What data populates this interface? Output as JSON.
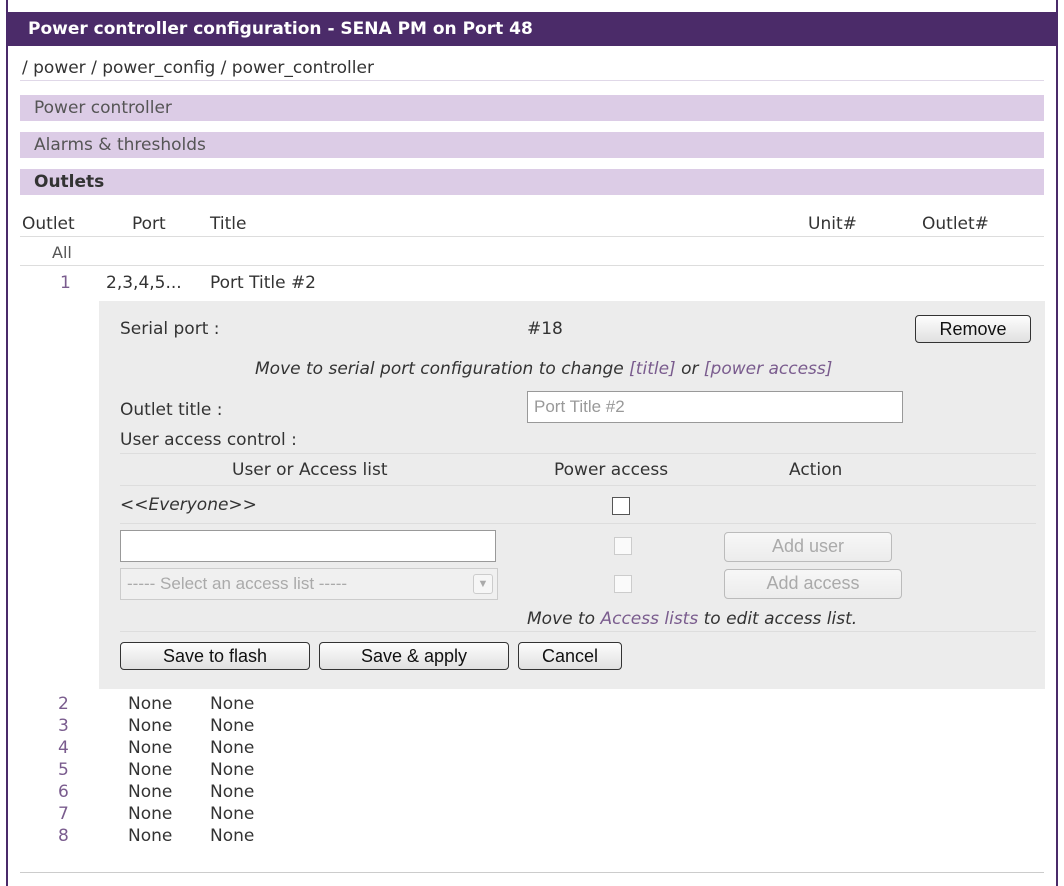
{
  "header": {
    "title": "Power controller configuration - SENA PM on Port 48"
  },
  "breadcrumb": "/ power / power_config / power_controller",
  "sections": [
    {
      "label": "Power controller"
    },
    {
      "label": "Alarms & thresholds"
    },
    {
      "label": "Outlets"
    }
  ],
  "table": {
    "columns": [
      "Outlet",
      "Port",
      "Title",
      "Unit#",
      "Outlet#"
    ],
    "all_label": "All",
    "expanded_row": {
      "outlet": "1",
      "port": "2,3,4,5...",
      "title": "Port Title #2"
    },
    "rows": [
      {
        "outlet": "2",
        "port": "None",
        "title": "None"
      },
      {
        "outlet": "3",
        "port": "None",
        "title": "None"
      },
      {
        "outlet": "4",
        "port": "None",
        "title": "None"
      },
      {
        "outlet": "5",
        "port": "None",
        "title": "None"
      },
      {
        "outlet": "6",
        "port": "None",
        "title": "None"
      },
      {
        "outlet": "7",
        "port": "None",
        "title": "None"
      },
      {
        "outlet": "8",
        "port": "None",
        "title": "None"
      }
    ]
  },
  "detail": {
    "serial_port_label": "Serial port :",
    "serial_port_value": "#18",
    "remove_button": "Remove",
    "hint_prefix": "Move to serial port configuration to change ",
    "hint_title_link": "[title]",
    "hint_or": " or ",
    "hint_power_link": "[power access]",
    "outlet_title_label": "Outlet title :",
    "outlet_title_value": "Port Title #2",
    "user_access_label": "User access control :",
    "acl_columns": {
      "user": "User or Access list",
      "power": "Power access",
      "action": "Action"
    },
    "everyone_label": "<<Everyone>>",
    "everyone_checked": false,
    "user_input_value": "",
    "add_user_button": "Add user",
    "access_list_select": "----- Select an access list -----",
    "add_access_button": "Add access",
    "acl_hint_prefix": "Move to ",
    "acl_hint_link": "Access lists",
    "acl_hint_suffix": " to edit access list.",
    "save_flash_button": "Save to flash",
    "save_apply_button": "Save & apply",
    "cancel_button": "Cancel"
  }
}
